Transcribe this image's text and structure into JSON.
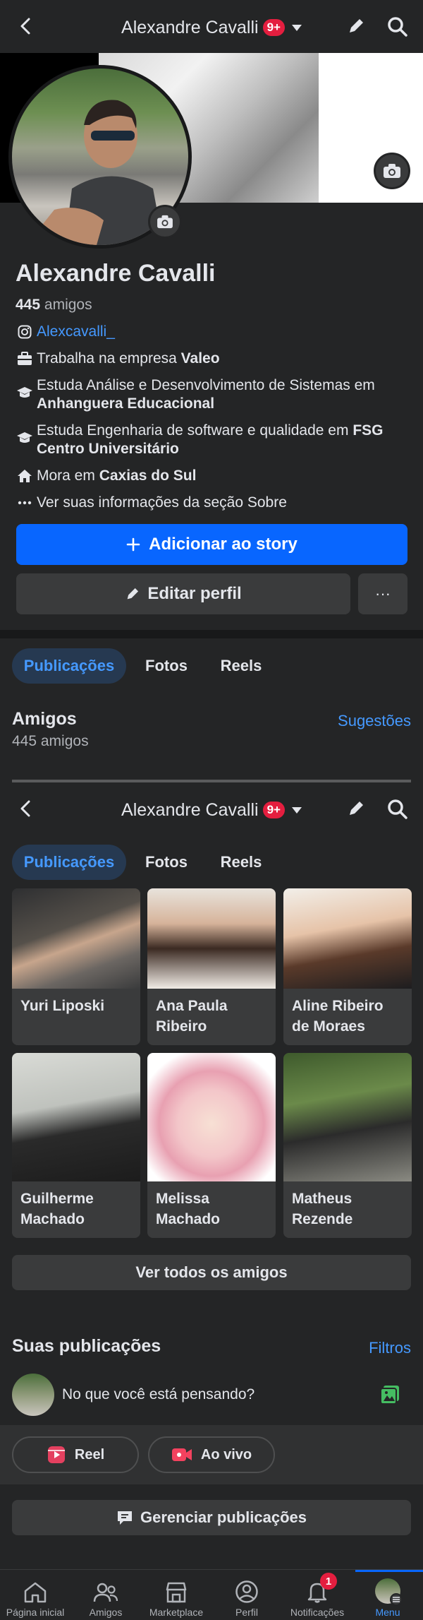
{
  "topbar": {
    "title": "Alexandre Cavalli",
    "badge": "9+"
  },
  "profile": {
    "name": "Alexandre Cavalli",
    "friends_count": "445",
    "friends_word": "amigos",
    "instagram": "Alexcavalli_",
    "work_prefix": "Trabalha na empresa ",
    "work_company": "Valeo",
    "study1_prefix": "Estuda Análise e Desenvolvimento de Sistemas em ",
    "study1_school": "Anhanguera Educacional",
    "study2_prefix": "Estuda Engenharia de software e qualidade em ",
    "study2_school": "FSG Centro Universitário",
    "lives_prefix": "Mora em ",
    "lives_city": "Caxias do Sul",
    "about": "Ver suas informações da seção Sobre"
  },
  "buttons": {
    "add_story": "Adicionar ao story",
    "edit_profile": "Editar perfil",
    "more": "···"
  },
  "tabs": [
    "Publicações",
    "Fotos",
    "Reels"
  ],
  "friends_section": {
    "title": "Amigos",
    "suggestions": "Sugestões",
    "count": "445 amigos",
    "see_all": "Ver todos os amigos",
    "friends": [
      {
        "name": "Yuri Liposki"
      },
      {
        "name": "Ana Paula Ribeiro"
      },
      {
        "name": "Aline Ribeiro de Moraes"
      },
      {
        "name": "Guilherme Machado"
      },
      {
        "name": "Melissa Machado"
      },
      {
        "name": "Matheus Rezende"
      }
    ]
  },
  "posts_section": {
    "title": "Suas publicações",
    "filters": "Filtros",
    "composer_placeholder": "No que você está pensando?",
    "reel": "Reel",
    "live": "Ao vivo",
    "manage": "Gerenciar publicações"
  },
  "bottom_nav": {
    "items": [
      "Página inicial",
      "Amigos",
      "Marketplace",
      "Perfil",
      "Notificações",
      "Menu"
    ],
    "notif_badge": "1",
    "active": "Menu"
  },
  "colors": {
    "accent": "#0866ff",
    "link": "#4599ff",
    "bg": "#242526",
    "surface": "#3a3b3c",
    "badge": "#e41e3f"
  }
}
